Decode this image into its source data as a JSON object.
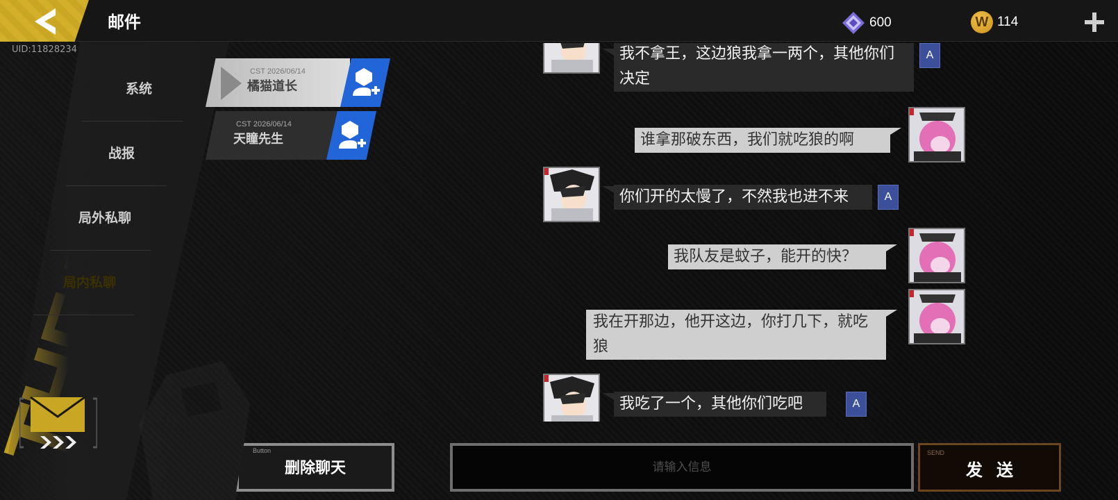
{
  "header": {
    "title": "邮件",
    "uid": "UID:11828234",
    "gems": "600",
    "coins": "114",
    "coin_symbol": "W",
    "accent_color": "#c9a623"
  },
  "decor": {
    "vertical_text": "THE WAR"
  },
  "tabs": [
    {
      "label": "系统",
      "active": false
    },
    {
      "label": "战报",
      "active": false
    },
    {
      "label": "局外私聊",
      "active": false
    },
    {
      "label": "局内私聊",
      "active": true
    }
  ],
  "chats": [
    {
      "date": "CST 2026/06/14",
      "name": "橘猫道长",
      "active": true
    },
    {
      "date": "CST 2026/06/14",
      "name": "天瞳先生",
      "active": false
    }
  ],
  "messages": [
    {
      "side": "left",
      "text": "我不拿王，这边狼我拿一两个，其他你们决定",
      "translate": "A"
    },
    {
      "side": "right",
      "text": "谁拿那破东西，我们就吃狼的啊"
    },
    {
      "side": "left",
      "text": "你们开的太慢了，不然我也进不来",
      "translate": "A"
    },
    {
      "side": "right",
      "text": "我队友是蚊子，能开的快？"
    },
    {
      "side": "right",
      "text": "我在开那边，他开这边，你打几下，就吃狼"
    },
    {
      "side": "left",
      "text": "我吃了一个，其他你们吃吧",
      "translate": "A"
    }
  ],
  "bottom": {
    "delete_small": "Button",
    "delete_label": "删除聊天",
    "input_placeholder": "请输入信息",
    "send_small": "SEND",
    "send_label": "发送"
  }
}
